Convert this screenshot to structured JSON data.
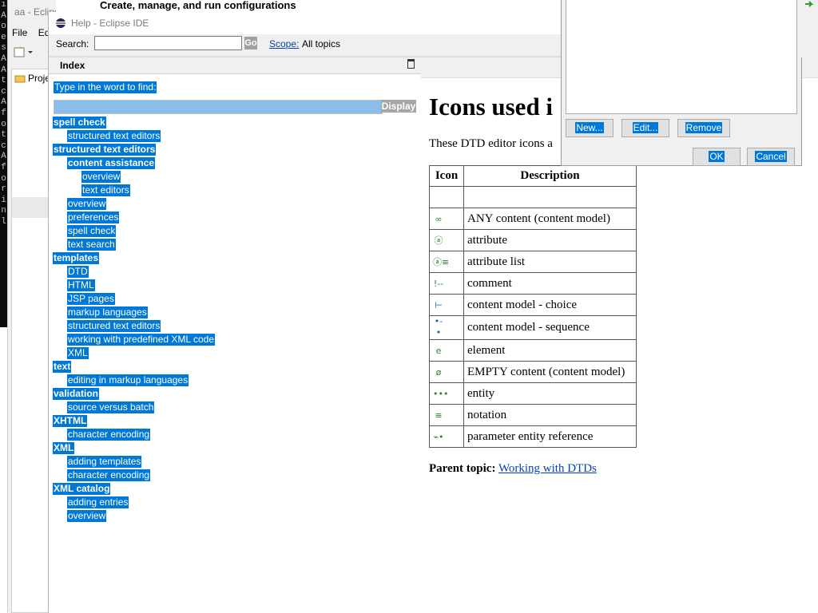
{
  "terminal": {
    "chars": [
      "ı",
      "A",
      "o",
      "e",
      "",
      "",
      "s",
      "A",
      "A",
      "t",
      "c",
      "A",
      "f",
      "o",
      "t",
      "c",
      "A",
      "f",
      "o",
      "r",
      "i",
      "n",
      "l"
    ]
  },
  "bg_ide": {
    "title": "aa - Eclipse IDE",
    "menu": [
      "File",
      "Ed"
    ],
    "project_label": "Proje"
  },
  "run_config": {
    "title": "Create, manage, and run configurations",
    "buttons": {
      "new": "New...",
      "edit": "Edit...",
      "remove": "Remove",
      "ok": "OK",
      "cancel": "Cancel"
    }
  },
  "help": {
    "window_title": "Help - Eclipse IDE",
    "search_label": "Search:",
    "search_value": "",
    "go_label": "Go",
    "scope_label": "Scope:",
    "scope_value": "All topics",
    "index": {
      "header": "Index",
      "find_label": "Type in the word to find:",
      "display_button": "Display",
      "entries": [
        {
          "text": "spell check",
          "level": 0
        },
        {
          "text": "structured text editors",
          "level": 1
        },
        {
          "text": "structured text editors",
          "level": 0
        },
        {
          "text": "content assistance",
          "level": 1,
          "bold": true
        },
        {
          "text": "overview",
          "level": 2
        },
        {
          "text": "text editors",
          "level": 2
        },
        {
          "text": "overview",
          "level": 1
        },
        {
          "text": "preferences",
          "level": 1
        },
        {
          "text": "spell check",
          "level": 1
        },
        {
          "text": "text search",
          "level": 1
        },
        {
          "text": "templates",
          "level": 0
        },
        {
          "text": "DTD",
          "level": 1
        },
        {
          "text": "HTML",
          "level": 1
        },
        {
          "text": "JSP pages",
          "level": 1
        },
        {
          "text": "markup languages",
          "level": 1
        },
        {
          "text": "structured text editors",
          "level": 1
        },
        {
          "text": "working with predefined XML code",
          "level": 1
        },
        {
          "text": "XML",
          "level": 1
        },
        {
          "text": "text",
          "level": 0
        },
        {
          "text": "editing in markup languages",
          "level": 1
        },
        {
          "text": "validation",
          "level": 0
        },
        {
          "text": "source versus batch",
          "level": 1
        },
        {
          "text": "XHTML",
          "level": 0
        },
        {
          "text": "character encoding",
          "level": 1
        },
        {
          "text": "XML",
          "level": 0
        },
        {
          "text": "adding templates",
          "level": 1
        },
        {
          "text": "character encoding",
          "level": 1
        },
        {
          "text": "XML catalog",
          "level": 0
        },
        {
          "text": "adding entries",
          "level": 1
        },
        {
          "text": "overview",
          "level": 1
        }
      ]
    },
    "content": {
      "title": "Icons used i",
      "intro": "These DTD editor icons a",
      "table_headers": [
        "Icon",
        "Description"
      ],
      "rows": [
        {
          "icon": "",
          "icon_name": "empty-icon",
          "desc": ""
        },
        {
          "icon": "∞",
          "icon_name": "any-content-icon",
          "desc": "ANY content (content model)"
        },
        {
          "icon": "ⓐ",
          "icon_name": "attribute-icon",
          "desc": "attribute"
        },
        {
          "icon": "ⓐ≡",
          "icon_name": "attribute-list-icon",
          "desc": "attribute list"
        },
        {
          "icon": "!--",
          "icon_name": "comment-icon",
          "desc": "comment"
        },
        {
          "icon": "⊢",
          "icon_name": "content-model-choice-icon",
          "desc": "content model - choice"
        },
        {
          "icon": "•-•",
          "icon_name": "content-model-sequence-icon",
          "desc": "content model - sequence"
        },
        {
          "icon": "e",
          "icon_name": "element-icon",
          "desc": "element"
        },
        {
          "icon": "ø",
          "icon_name": "empty-content-icon",
          "desc": "EMPTY content (content model)"
        },
        {
          "icon": "•••",
          "icon_name": "entity-icon",
          "desc": "entity"
        },
        {
          "icon": "≡",
          "icon_name": "notation-icon",
          "desc": "notation"
        },
        {
          "icon": "⌁•",
          "icon_name": "parameter-entity-reference-icon",
          "desc": "parameter entity reference"
        }
      ],
      "parent_label": "Parent topic:",
      "parent_link": "Working with DTDs"
    }
  },
  "colors": {
    "selection": "#0078d7",
    "link": "#0645ad"
  }
}
